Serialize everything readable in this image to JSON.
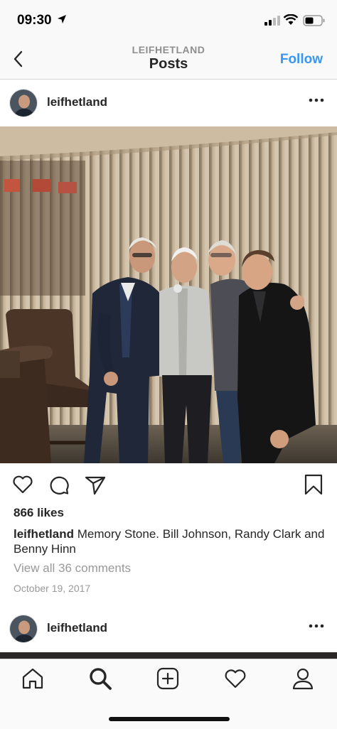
{
  "status_bar": {
    "time": "09:30"
  },
  "header": {
    "subtitle": "LEIFHETLAND",
    "title": "Posts",
    "follow_label": "Follow"
  },
  "post": {
    "username": "leifhetland",
    "likes": "866 likes",
    "caption_user": "leifhetland",
    "caption_text": " Memory Stone. Bill Johnson, Randy Clark and Benny Hinn",
    "view_comments": "View all 36 comments",
    "date": "October 19, 2017"
  },
  "next_post": {
    "username": "leifhetland"
  },
  "icons": {
    "back": "chevron-left-icon",
    "more": "more-dots-icon",
    "like": "heart-icon",
    "comment": "comment-bubble-icon",
    "share": "paper-plane-icon",
    "save": "bookmark-icon",
    "tabs": [
      "home-icon",
      "search-icon",
      "add-post-icon",
      "activity-heart-icon",
      "profile-icon"
    ]
  },
  "colors": {
    "accent": "#3897f0",
    "text": "#262626",
    "muted": "#999999"
  }
}
